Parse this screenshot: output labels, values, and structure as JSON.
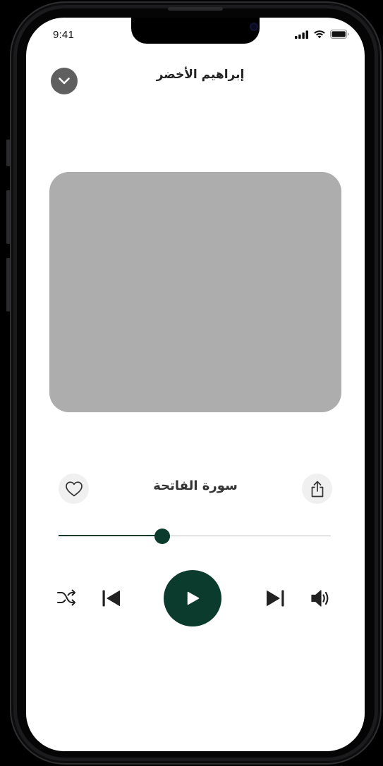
{
  "status_bar": {
    "time": "9:41"
  },
  "header": {
    "title": "إبراهيم الأخضر"
  },
  "track": {
    "title": "سورة الفاتحة"
  },
  "progress": {
    "fraction": 0.38
  },
  "icons": {
    "collapse": "chevron-down-icon",
    "favorite": "heart-icon",
    "share": "share-icon",
    "shuffle": "shuffle-icon",
    "previous": "skip-previous-icon",
    "play": "play-icon",
    "next": "skip-next-icon",
    "volume": "volume-icon"
  },
  "colors": {
    "accent": "#0b3b2c",
    "artwork_placeholder": "#adadad",
    "collapse_button": "#5f5f5f",
    "icon_button_bg": "#f0f0f0"
  }
}
